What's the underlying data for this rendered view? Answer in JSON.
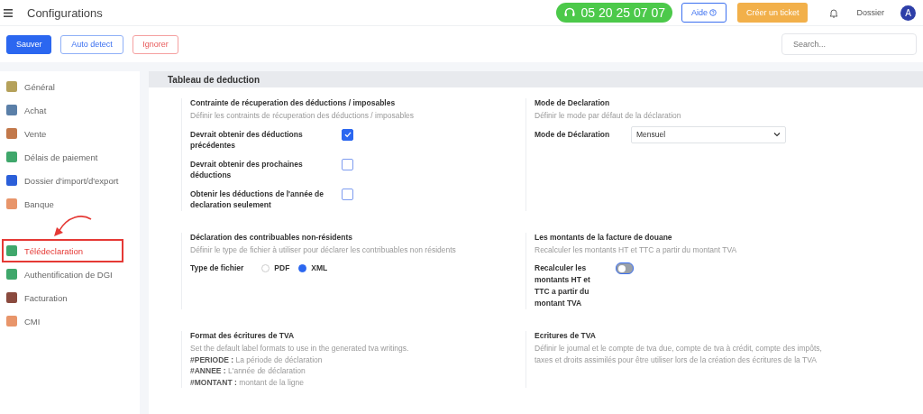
{
  "header": {
    "title": "Configurations",
    "phone": "05 20 25 07 07",
    "help": "Aide",
    "ticket": "Créer un ticket",
    "folder": "Dossier",
    "avatar": "A"
  },
  "toolbar": {
    "buttons": [
      {
        "label": "Sauver",
        "kind": "primary"
      },
      {
        "label": "Auto detect",
        "kind": "outline"
      },
      {
        "label": "Ignorer",
        "kind": "danger"
      }
    ],
    "search": {
      "placeholder": "Search..."
    }
  },
  "sidebar": {
    "items": [
      {
        "label": "Général",
        "color": "#b5a15a",
        "selected": false,
        "annotated": false
      },
      {
        "label": "Achat",
        "color": "#5a7fa8",
        "selected": false,
        "annotated": false
      },
      {
        "label": "Vente",
        "color": "#c2784a",
        "selected": false,
        "annotated": false
      },
      {
        "label": "Délais de paiement",
        "color": "#3fa76b",
        "selected": false,
        "annotated": false
      },
      {
        "label": "Dossier d'import/d'export",
        "color": "#2b5fd9",
        "selected": false,
        "annotated": false
      },
      {
        "label": "Banque",
        "color": "#e8956a",
        "selected": false,
        "annotated": false
      },
      {
        "label": "Télédeclaration",
        "color": "#3fa76b",
        "selected": true,
        "annotated": true
      },
      {
        "label": "Authentification de DGI",
        "color": "#3fa76b",
        "selected": false,
        "annotated": false
      },
      {
        "label": "Facturation",
        "color": "#8a4a3e",
        "selected": false,
        "annotated": false
      },
      {
        "label": "CMI",
        "color": "#e8956a",
        "selected": false,
        "annotated": false
      }
    ]
  },
  "panel": {
    "title": "Tableau de deduction",
    "sections": [
      {
        "kind": "checkboxes",
        "title": "Contrainte de récuperation des déductions / imposables",
        "description": [
          "Définir les contraints de récuperation des déductions / imposables"
        ],
        "items": [
          {
            "label": "Devrait obtenir des déductions précédentes",
            "checked": true
          },
          {
            "label": "Devrait obtenir des prochaines déductions",
            "checked": false
          },
          {
            "label": "Obtenir les déductions de l'année de declaration seulement",
            "checked": false
          }
        ]
      },
      {
        "kind": "select",
        "title": "Mode de Declaration",
        "description": [
          "Définir le mode par défaut de la déclaration"
        ],
        "label": "Mode de Déclaration",
        "value": "Mensuel"
      },
      {
        "kind": "radio",
        "title": "Déclaration des contribuables non-résidents",
        "description": [
          "Définir le type de fichier à utiliser pour déclarer les contribuables non résidents"
        ],
        "label": "Type de fichier",
        "options": [
          {
            "label": "PDF",
            "selected": false
          },
          {
            "label": "XML",
            "selected": true
          }
        ]
      },
      {
        "kind": "toggle",
        "title": "Les montants de la facture de douane",
        "description": [
          "Recalculer les montants HT et TTC a partir du montant TVA"
        ],
        "label": "Recalculer les montants HT et TTC a partir du montant TVA",
        "on": false
      },
      {
        "kind": "text",
        "title": "Format des écritures de TVA",
        "description": [
          "Set the default label formats to use in the generated tva writings.",
          "**#PERIODE :** La période de déclaration",
          "**#ANNEE :** L'année de déclaration",
          "**#MONTANT :** montant de la ligne"
        ]
      },
      {
        "kind": "text",
        "title": "Ecritures de TVA",
        "description": [
          "Définir le journal et le compte de tva due, compte de tva à crédit, compte des impôts, taxes et droits assimilés pour être utiliser lors de la création des écritures de la TVA"
        ]
      }
    ]
  }
}
